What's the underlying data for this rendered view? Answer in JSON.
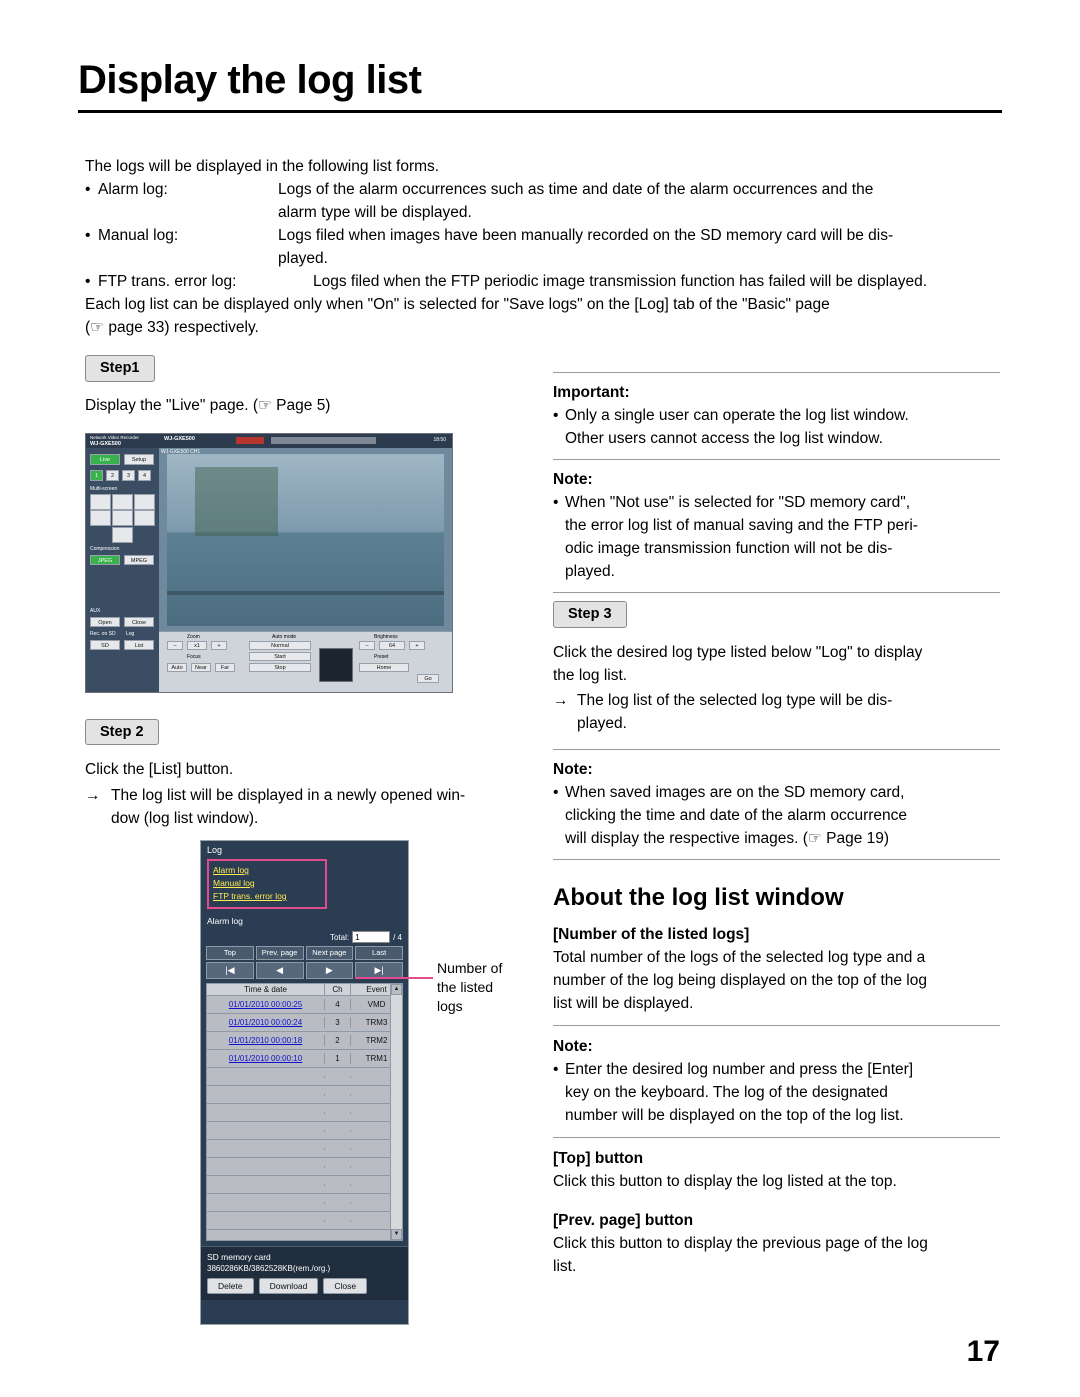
{
  "title": "Display the log list",
  "intro": {
    "lead": "The logs will be displayed in the following list forms.",
    "items": [
      {
        "label": "Alarm log:",
        "line1": "Logs of the alarm occurrences such as time and date of the alarm occurrences and the",
        "line2": "alarm type will be displayed."
      },
      {
        "label": "Manual log:",
        "line1": "Logs filed when images have been manually recorded on the SD memory card will be dis-",
        "line2": "played."
      },
      {
        "label": "FTP trans. error log:",
        "line1": "Logs filed when the FTP periodic image transmission function has failed will be displayed.",
        "line2": ""
      }
    ],
    "closing1": "Each log list can be displayed only when \"On\" is selected for \"Save logs\" on the [Log] tab of the \"Basic\" page",
    "closing2": "(☞ page 33) respectively."
  },
  "left": {
    "step1_badge": "Step1",
    "step1_text": "Display the \"Live\" page. (☞ Page 5)",
    "step2_badge": "Step 2",
    "step2_text": "Click the [List] button.",
    "step2_arrow": "→",
    "step2_arrow_line1": "The log list will be displayed in a newly opened win-",
    "step2_arrow_line2": "dow (log list window).",
    "callout_line1": "Number of",
    "callout_line2": "the listed",
    "callout_line3": "logs"
  },
  "live_screenshot": {
    "brand_left": "Network Video Recorder",
    "brand_model": "WJ-GXE500",
    "sub_model": "WJ-GXE500",
    "channel": "WJ-GXE500  CH1",
    "clock": "18:50",
    "tab_live": "Live",
    "tab_setup": "Setup",
    "multiscreen": "Multi-screen",
    "compression": "Compression",
    "comp_opts": [
      "JPEG",
      "MPEG"
    ],
    "aux": "AUX",
    "aux_opts": [
      "Open",
      "Close"
    ],
    "rec_on_sd": "Rec. on SD",
    "log": "Log",
    "rec_opts": [
      "SD",
      "List"
    ],
    "zoom": "Zoom",
    "auto_mode": "Auto mode",
    "brightness": "Brightness",
    "focus": "Focus",
    "preset": "Preset",
    "btn_start": "Start",
    "btn_stop": "Stop",
    "btn_auto": "Auto",
    "btn_near": "Near",
    "btn_far": "Far",
    "btn_normal": "Normal",
    "btn_home": "Home",
    "btn_go": "Go",
    "ch_numbers": [
      "1",
      "2",
      "3",
      "4"
    ]
  },
  "log_window": {
    "title": "Log",
    "links": [
      "Alarm log",
      "Manual log",
      "FTP trans. error log"
    ],
    "section": "Alarm log",
    "total_label": "Total:",
    "total_value": "1",
    "total_suffix": "/ 4",
    "buttons": [
      "Top",
      "Prev. page",
      "Next page",
      "Last"
    ],
    "nav": [
      "|◀",
      "◀",
      "▶",
      "▶|"
    ],
    "columns": [
      "Time & date",
      "Ch",
      "Event"
    ],
    "rows": [
      {
        "time": "01/01/2010 00:00:25",
        "ch": "4",
        "event": "VMD"
      },
      {
        "time": "01/01/2010 00:00:24",
        "ch": "3",
        "event": "TRM3"
      },
      {
        "time": "01/01/2010 00:00:18",
        "ch": "2",
        "event": "TRM2"
      },
      {
        "time": "01/01/2010 00:00:10",
        "ch": "1",
        "event": "TRM1"
      }
    ],
    "sd_label": "SD memory card",
    "sd_value": "3860286KB/3862528KB(rem./org.)",
    "footer_buttons": [
      "Delete",
      "Download",
      "Close"
    ]
  },
  "right": {
    "important_head": "Important:",
    "important_line1": "Only a single user can operate the log list window.",
    "important_line2": "Other users cannot access the log list window.",
    "note1_head": "Note:",
    "note1_lines": [
      "When \"Not use\" is selected for \"SD memory card\",",
      "the error log list of manual saving and the FTP peri-",
      "odic image transmission function will not be dis-",
      "played."
    ],
    "step3_badge": "Step 3",
    "step3_line1": "Click the desired log type listed below \"Log\" to display",
    "step3_line2": "the log list.",
    "step3_arrow": "→",
    "step3_arrow_line1": "The log list of the selected log type will be dis-",
    "step3_arrow_line2": "played.",
    "note2_head": "Note:",
    "note2_lines": [
      "When saved images are on the SD memory card,",
      "clicking the time and date of the alarm occurrence",
      "will display the respective images. (☞ Page 19)"
    ],
    "about_title": "About the log list window",
    "num_head": "[Number of the listed logs]",
    "num_lines": [
      "Total number of the logs of the selected log type and a",
      "number of the log being displayed on the top of the log",
      "list will be displayed."
    ],
    "note3_head": "Note:",
    "note3_lines": [
      "Enter the desired log number and press the [Enter]",
      "key on the keyboard. The log of the designated",
      "number will be displayed on the top of the log list."
    ],
    "top_head": "[Top] button",
    "top_text": "Click this button to display the log listed at the top.",
    "prev_head": "[Prev. page] button",
    "prev_line1": "Click this button to display the previous page of the log",
    "prev_line2": "list."
  },
  "page_number": "17"
}
